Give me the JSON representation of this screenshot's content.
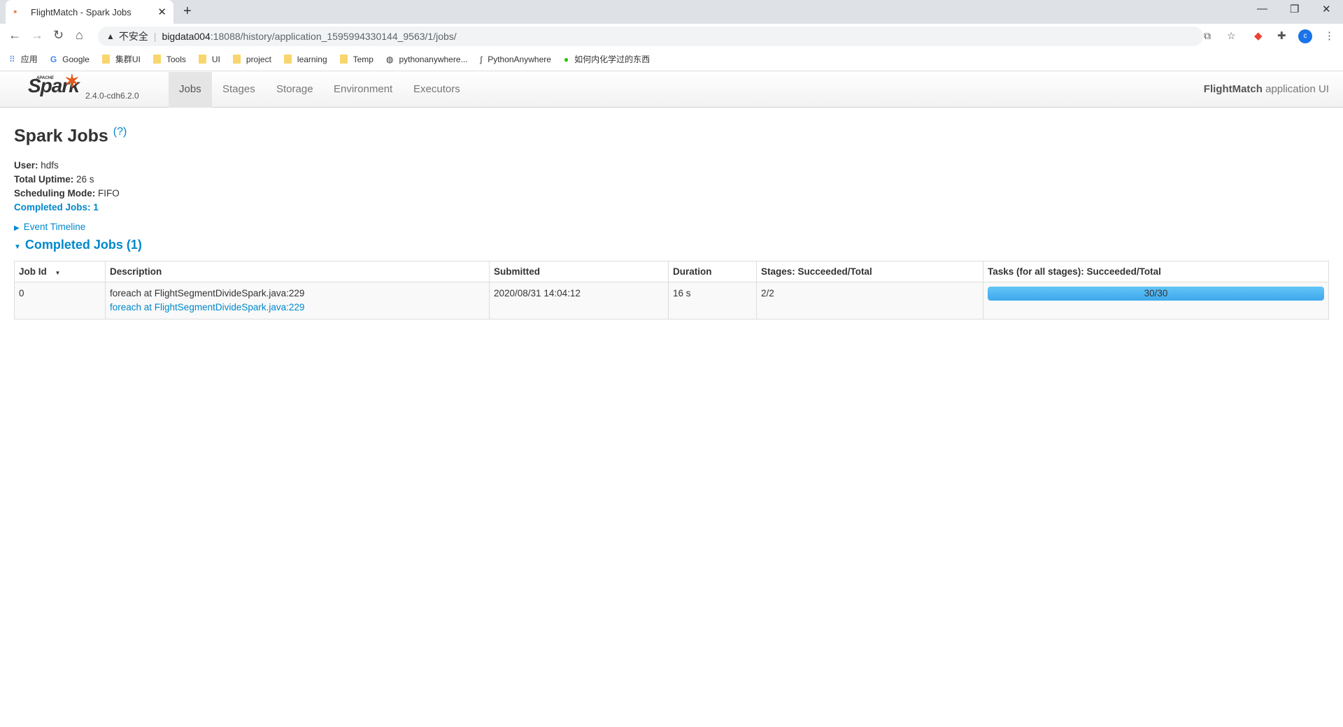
{
  "browser": {
    "tab_title": "FlightMatch - Spark Jobs",
    "security": "不安全",
    "url_host": "bigdata004",
    "url_path": ":18088/history/application_1595994330144_9563/1/jobs/",
    "profile_initial": "c",
    "bookmarks": [
      {
        "label": "应用",
        "icon": "apps-grid-icon"
      },
      {
        "label": "Google",
        "icon": "google-icon"
      },
      {
        "label": "集群UI",
        "icon": "folder-icon"
      },
      {
        "label": "Tools",
        "icon": "folder-icon"
      },
      {
        "label": "UI",
        "icon": "folder-icon"
      },
      {
        "label": "project",
        "icon": "folder-icon"
      },
      {
        "label": "learning",
        "icon": "folder-icon"
      },
      {
        "label": "Temp",
        "icon": "folder-icon"
      },
      {
        "label": "pythonanywhere...",
        "icon": "globe-icon"
      },
      {
        "label": "PythonAnywhere",
        "icon": "pythonanywhere-icon"
      },
      {
        "label": "如何内化学过的东西",
        "icon": "wechat-icon"
      }
    ]
  },
  "spark": {
    "version": "2.4.0-cdh6.2.0",
    "nav": [
      {
        "label": "Jobs",
        "active": true
      },
      {
        "label": "Stages"
      },
      {
        "label": "Storage"
      },
      {
        "label": "Environment"
      },
      {
        "label": "Executors"
      }
    ],
    "app_name": "FlightMatch",
    "app_suffix": "application UI"
  },
  "page": {
    "title": "Spark Jobs",
    "help": "(?)",
    "user_label": "User:",
    "user": "hdfs",
    "uptime_label": "Total Uptime:",
    "uptime": "26 s",
    "mode_label": "Scheduling Mode:",
    "mode": "FIFO",
    "completed_label": "Completed Jobs:",
    "completed": "1",
    "event_timeline": "Event Timeline",
    "section_title": "Completed Jobs (1)"
  },
  "table": {
    "headers": [
      "Job Id",
      "Description",
      "Submitted",
      "Duration",
      "Stages: Succeeded/Total",
      "Tasks (for all stages): Succeeded/Total"
    ],
    "rows": [
      {
        "id": "0",
        "desc": "foreach at FlightSegmentDivideSpark.java:229",
        "desc_link": "foreach at FlightSegmentDivideSpark.java:229",
        "submitted": "2020/08/31 14:04:12",
        "duration": "16 s",
        "stages": "2/2",
        "tasks": "30/30",
        "tasks_progress": 1.0
      }
    ]
  },
  "colors": {
    "accent": "#0088cc",
    "progress": "#4fb3f0",
    "spark_orange": "#e25a1c"
  }
}
